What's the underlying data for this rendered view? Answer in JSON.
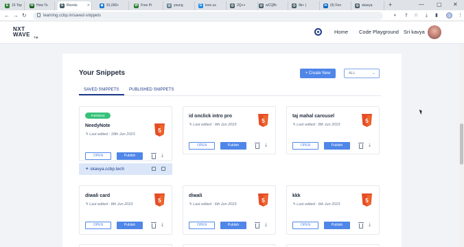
{
  "browser": {
    "tabs": [
      {
        "label": "15 Top",
        "color": "#2e7d32"
      },
      {
        "label": "How To",
        "color": "#1b5e20"
      },
      {
        "label": "Revolu",
        "color": "#455a64"
      },
      {
        "label": "91,000+",
        "color": "#1976d2"
      },
      {
        "label": "Free Pi",
        "color": "#2e7d32"
      },
      {
        "label": "young",
        "color": "#607d8b"
      },
      {
        "label": "love us",
        "color": "#1e88e5"
      },
      {
        "label": "2Q++",
        "color": "#455a64"
      },
      {
        "label": "wCQBr",
        "color": "#455a64"
      },
      {
        "label": "9k+ (",
        "color": "#455a64"
      },
      {
        "label": "(9) Fen",
        "color": "#0a66c2"
      },
      {
        "label": "skavya",
        "color": "#455a64"
      }
    ],
    "url": "learning.ccbp.in/saved-snippets"
  },
  "header": {
    "logo_line1": "NXT",
    "logo_line2": "WAVE",
    "logo_sub": "TM",
    "nav": [
      "Home",
      "Code Playground"
    ],
    "user": "Sri kavya"
  },
  "page": {
    "title": "Your Snippets",
    "create_label": "+ Create New",
    "filter_value": "ALL",
    "tabs": [
      "SAVED SNIPPETS",
      "PUBLISHED SNIPPETS"
    ]
  },
  "cards": [
    {
      "title": "NeedyNote",
      "date": "Last edited : 18th Jun 2023",
      "badge": "Published",
      "open": "OPEN",
      "publish": "Publish"
    },
    {
      "title": "id onclick intro pro",
      "date": "Last edited : 9th Jun 2023",
      "open": "OPEN",
      "publish": "Publish"
    },
    {
      "title": "taj mahal carousel",
      "date": "Last edited : 8th Jun 2023",
      "open": "OPEN",
      "publish": "Publish"
    },
    {
      "title": "diwali card",
      "date": "Last edited : 8th Jun 2023",
      "open": "OPEN",
      "publish": "Publish"
    },
    {
      "title": "diwali",
      "date": "Last edited : 6th Jun 2023",
      "open": "OPEN",
      "publish": "Publish"
    },
    {
      "title": "kkk",
      "date": "Last edited : 6th Jun 2023",
      "open": "OPEN",
      "publish": "Publish"
    }
  ],
  "published_link": "skavya.ccbp.tech",
  "colors": {
    "accent": "#4f86e8",
    "badge": "#36c27a",
    "html5": "#e44d26"
  }
}
